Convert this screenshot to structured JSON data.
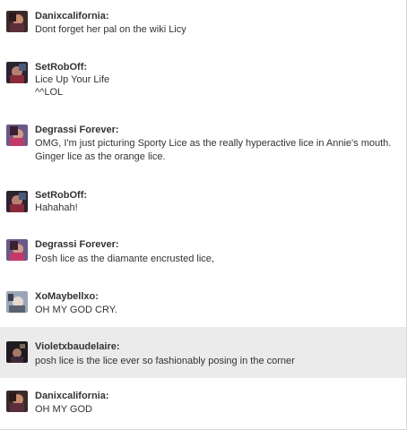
{
  "messages": [
    {
      "user": "Danixcalifornia:",
      "lines": [
        "Dont forget her pal on the wiki Licy"
      ],
      "avatar_icon": "user-avatar-icon",
      "highlighted": false
    },
    {
      "user": "SetRobOff:",
      "lines": [
        "Lice Up Your Life",
        "^^LOL"
      ],
      "avatar_icon": "user-avatar-icon",
      "highlighted": false
    },
    {
      "user": "Degrassi Forever:",
      "lines": [
        "OMG, I'm just picturing Sporty Lice as the really hyperactive lice in Annie's mouth.",
        "Ginger lice as the orange lice."
      ],
      "avatar_icon": "user-avatar-icon",
      "highlighted": false
    },
    {
      "user": "SetRobOff:",
      "lines": [
        "Hahahah!"
      ],
      "avatar_icon": "user-avatar-icon",
      "highlighted": false
    },
    {
      "user": "Degrassi Forever:",
      "lines": [
        "Posh lice as the diamante encrusted lice,"
      ],
      "avatar_icon": "user-avatar-icon",
      "highlighted": false
    },
    {
      "user": "XoMaybellxo:",
      "lines": [
        "OH MY GOD CRY."
      ],
      "avatar_icon": "user-avatar-icon",
      "highlighted": false
    },
    {
      "user": "Violetxbaudelaire:",
      "lines": [
        "posh lice is the lice ever so fashionably posing in the corner"
      ],
      "avatar_icon": "user-avatar-icon",
      "highlighted": true
    },
    {
      "user": "Danixcalifornia:",
      "lines": [
        "OH MY GOD"
      ],
      "avatar_icon": "user-avatar-icon",
      "highlighted": false
    }
  ],
  "colors": {
    "text": "#333333",
    "highlight": "#ebebeb",
    "border": "#d8d8d8"
  }
}
